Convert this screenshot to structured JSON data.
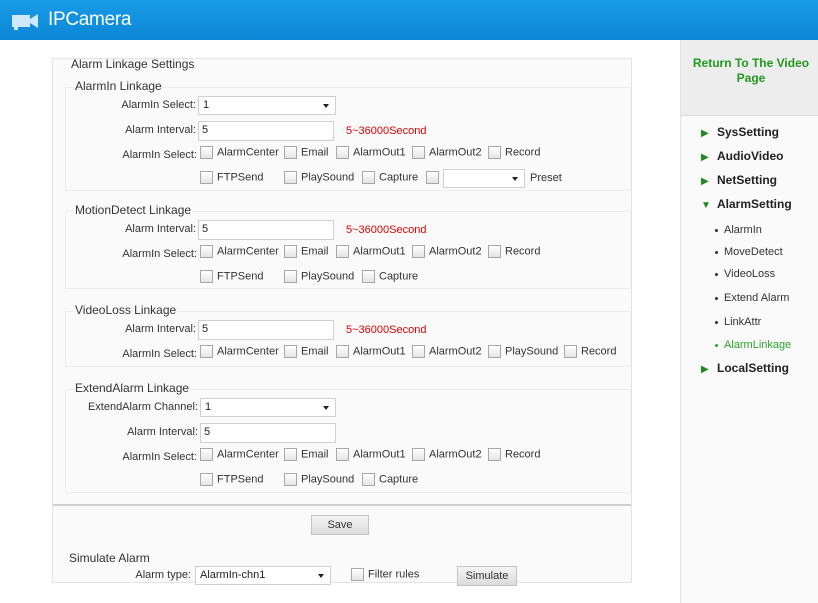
{
  "app": {
    "title": "IPCamera"
  },
  "settings_title": "Alarm Linkage Settings",
  "alarmin": {
    "title": "AlarmIn Linkage",
    "select_label": "AlarmIn Select:",
    "select_value": "1",
    "interval_label": "Alarm Interval:",
    "interval_value": "5",
    "interval_hint": "5~36000Second",
    "checks_label": "AlarmIn Select:",
    "checks_row1": [
      "AlarmCenter",
      "Email",
      "AlarmOut1",
      "AlarmOut2",
      "Record"
    ],
    "checks_row2": [
      "FTPSend",
      "PlaySound",
      "Capture"
    ],
    "preset_label": "Preset",
    "preset_value": ""
  },
  "motion": {
    "title": "MotionDetect Linkage",
    "interval_label": "Alarm Interval:",
    "interval_value": "5",
    "interval_hint": "5~36000Second",
    "checks_label": "AlarmIn Select:",
    "checks_row1": [
      "AlarmCenter",
      "Email",
      "AlarmOut1",
      "AlarmOut2",
      "Record"
    ],
    "checks_row2": [
      "FTPSend",
      "PlaySound",
      "Capture"
    ]
  },
  "videoloss": {
    "title": "VideoLoss Linkage",
    "interval_label": "Alarm Interval:",
    "interval_value": "5",
    "interval_hint": "5~36000Second",
    "checks_label": "AlarmIn Select:",
    "checks_row1": [
      "AlarmCenter",
      "Email",
      "AlarmOut1",
      "AlarmOut2",
      "PlaySound",
      "Record"
    ]
  },
  "extend": {
    "title": "ExtendAlarm Linkage",
    "channel_label": "ExtendAlarm Channel:",
    "channel_value": "1",
    "interval_label": "Alarm Interval:",
    "interval_value": "5",
    "checks_label": "AlarmIn Select:",
    "checks_row1": [
      "AlarmCenter",
      "Email",
      "AlarmOut1",
      "AlarmOut2",
      "Record"
    ],
    "checks_row2": [
      "FTPSend",
      "PlaySound",
      "Capture"
    ]
  },
  "save_label": "Save",
  "simulate": {
    "title": "Simulate Alarm",
    "type_label": "Alarm type:",
    "type_value": "AlarmIn-chn1",
    "filter_label": "Filter rules",
    "button_label": "Simulate"
  },
  "sidebar": {
    "return_label": "Return To The Video Page",
    "menu": [
      {
        "label": "SysSetting"
      },
      {
        "label": "AudioVideo"
      },
      {
        "label": "NetSetting"
      },
      {
        "label": "AlarmSetting"
      }
    ],
    "submenu": [
      "AlarmIn",
      "MoveDetect",
      "VideoLoss",
      "Extend Alarm",
      "LinkAttr",
      "AlarmLinkage"
    ],
    "local": "LocalSetting"
  },
  "colors": {
    "header": "#0a87d6",
    "hint": "#e00000",
    "link": "#1f9a1f",
    "active_sub": "#2aa52a"
  }
}
